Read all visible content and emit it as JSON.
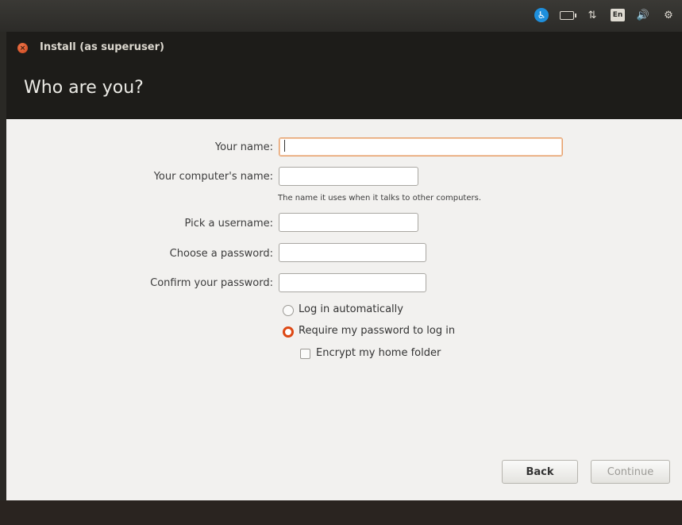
{
  "topbar": {
    "icons": [
      "accessibility-icon",
      "battery-icon",
      "network-icon",
      "keyboard-layout-icon",
      "volume-icon",
      "settings-gear-icon"
    ],
    "keyboard_layout": "En"
  },
  "window": {
    "title": "Install (as superuser)",
    "page_title": "Who are you?"
  },
  "form": {
    "your_name_label": "Your name:",
    "your_name_value": "",
    "computer_name_label": "Your computer's name:",
    "computer_name_value": "",
    "computer_name_hint": "The name it uses when it talks to other computers.",
    "username_label": "Pick a username:",
    "username_value": "",
    "password_label": "Choose a password:",
    "password_value": "",
    "confirm_label": "Confirm your password:",
    "confirm_value": "",
    "login_options": [
      {
        "label": "Log in automatically",
        "selected": false
      },
      {
        "label": "Require my password to log in",
        "selected": true
      }
    ],
    "encrypt_label": "Encrypt my home folder",
    "encrypt_checked": false
  },
  "buttons": {
    "back": "Back",
    "continue": "Continue"
  },
  "colors": {
    "accent": "#dd4814",
    "header_bg": "#1d1c19",
    "panel_bg": "#2c2b28",
    "content_bg": "#f2f1ef"
  }
}
